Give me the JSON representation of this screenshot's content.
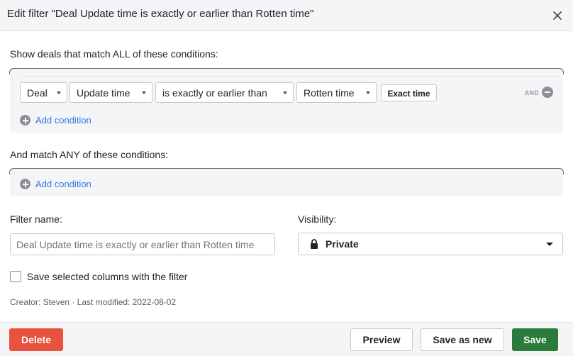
{
  "dialog": {
    "title": "Edit filter \"Deal Update time is exactly or earlier than Rotten time\""
  },
  "all_conditions": {
    "label": "Show deals that match ALL of these conditions:",
    "rows": [
      {
        "entity": "Deal",
        "field": "Update time",
        "operator": "is exactly or earlier than",
        "value": "Rotten time",
        "mode_button": "Exact time",
        "connector": "AND"
      }
    ],
    "add_label": "Add condition"
  },
  "any_conditions": {
    "label": "And match ANY of these conditions:",
    "add_label": "Add condition"
  },
  "filter_name": {
    "label": "Filter name:",
    "placeholder": "Deal Update time is exactly or earlier than Rotten time"
  },
  "visibility": {
    "label": "Visibility:",
    "selected": "Private",
    "icon": "lock-icon"
  },
  "save_columns": {
    "label": "Save selected columns with the filter",
    "checked": false
  },
  "meta": {
    "text": "Creator: Steven · Last modified: 2022-08-02"
  },
  "footer": {
    "delete_label": "Delete",
    "preview_label": "Preview",
    "save_as_new_label": "Save as new",
    "save_label": "Save"
  },
  "colors": {
    "delete": "#e8523f",
    "save": "#2a7a3b",
    "link": "#317ae2",
    "panel": "#f5f5f7"
  }
}
